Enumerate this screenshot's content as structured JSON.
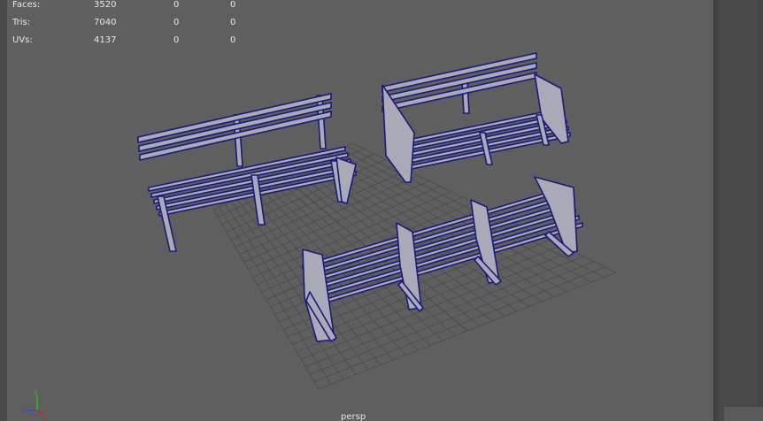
{
  "hud": {
    "rows": [
      {
        "label": "Faces:",
        "total": "3520",
        "selected": "0",
        "components": "0"
      },
      {
        "label": "Tris:",
        "total": "7040",
        "selected": "0",
        "components": "0"
      },
      {
        "label": "UVs:",
        "total": "4137",
        "selected": "0",
        "components": "0"
      }
    ]
  },
  "viewport": {
    "camera": "persp",
    "object_count": 3,
    "object_type": "bench",
    "colors": {
      "background": "#5f5f5f",
      "grid": "#4b4b4b",
      "mesh_fill": "#a9a9b8",
      "wireframe": "#1a1a7a"
    }
  },
  "axis": {
    "y_label": "y",
    "x_label": "x",
    "z_label": "z",
    "colors": {
      "x": "#d02020",
      "y": "#20c020",
      "z": "#2050e0"
    }
  }
}
